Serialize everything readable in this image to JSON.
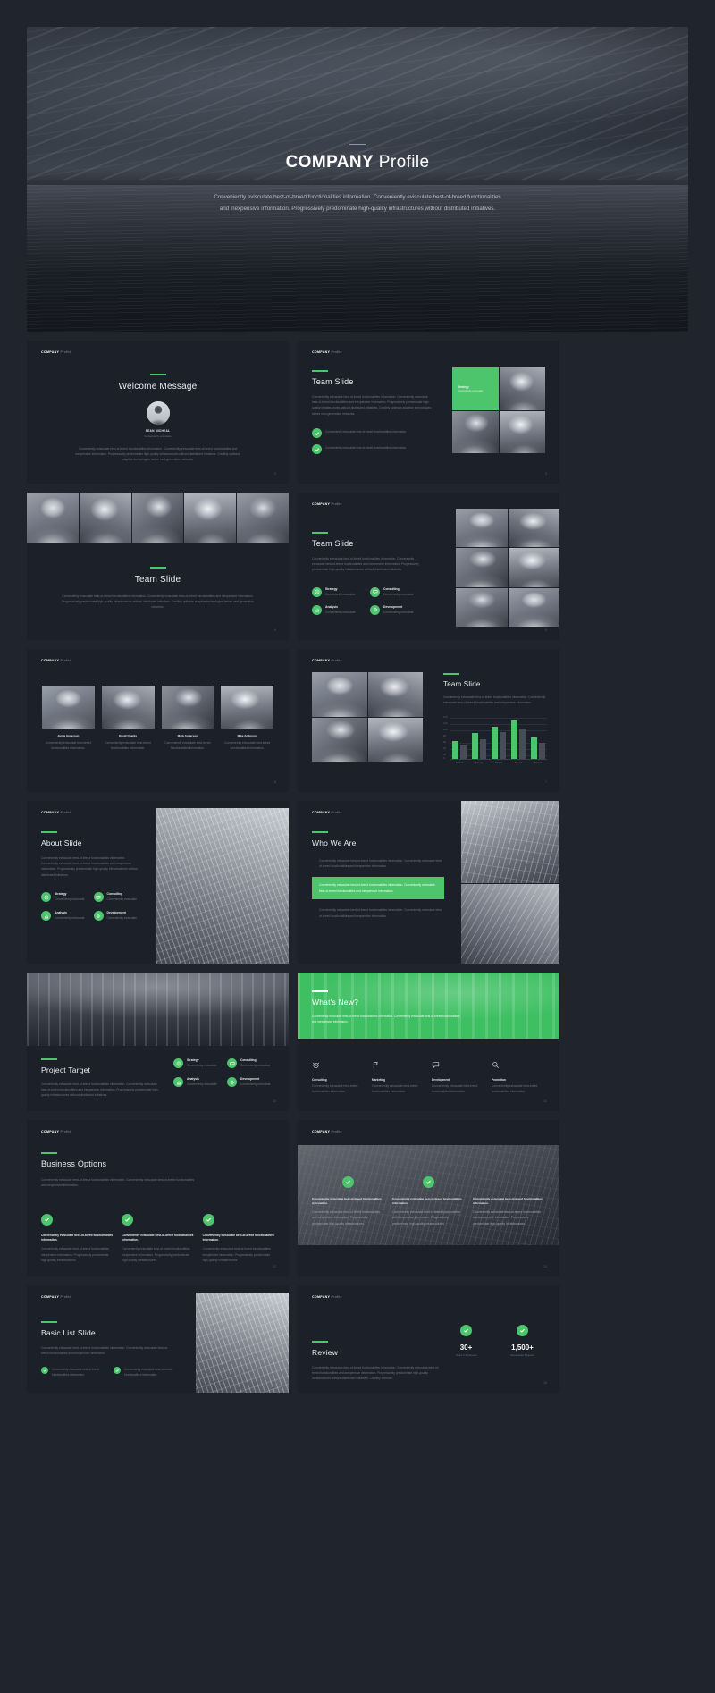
{
  "brand": {
    "accent_green": "#4cc56c",
    "background": "#20242d",
    "slide_background": "#1c2029"
  },
  "logo": {
    "bold": "COMPANY",
    "light": "Profile"
  },
  "hero": {
    "title_bold": "COMPANY",
    "title_light": "Profile",
    "paragraph": "Conveniently evisculate best-of-breed functionalities information. Conveniently evisculate best-of-breed functionalities and inexpensive information. Progressively predominate high-quality infrastructures without distributed initiatives."
  },
  "lorem": {
    "short": "Conveniently evisculate best-of-breed functionalities information. Conveniently evisculate best-of-breed functionalities and inexpensive information.",
    "medium": "Conveniently evisculate best-of-breed functionalities information. Conveniently evisculate best-of-breed functionalities and inexpensive information. Progressively predominate high-quality infrastructures without distributed initiatives.",
    "long": "Conveniently evisculate best-of-breed functionalities information. Conveniently evisculate best-of-breed functionalities and inexpensive information. Progressively predominate high-quality infrastructures without distributed initiatives. Credibly optimize adaptive technologies before next-generation networks.",
    "tiny": "Conveniently evisculate best-of-breed functionalities information.",
    "micro": "Conveniently evisculate"
  },
  "slides": {
    "welcome": {
      "title": "Welcome Message",
      "person_name": "SEAN MICHEAL",
      "person_role": "Conveniently evisculate",
      "page": "2"
    },
    "team_1": {
      "title": "Team Slide",
      "green_tile_label": "Strategy",
      "green_tile_sub": "Conveniently evisculate",
      "page": "3"
    },
    "team_2": {
      "title": "Team Slide",
      "page": "4"
    },
    "team_3": {
      "title": "Team Slide",
      "features": [
        {
          "label": "Strategy",
          "desc": "Conveniently evisculate",
          "icon": "target-icon"
        },
        {
          "label": "Consulting",
          "desc": "Conveniently evisculate",
          "icon": "chat-icon"
        },
        {
          "label": "Analysis",
          "desc": "Conveniently evisculate",
          "icon": "chart-icon"
        },
        {
          "label": "Development",
          "desc": "Conveniently evisculate",
          "icon": "gear-icon"
        }
      ],
      "page": "5"
    },
    "team_members": {
      "members": [
        {
          "name": "Jamie Anderson",
          "desc": "Conveniently evisculate best-breed functionalities information."
        },
        {
          "name": "David Quarks",
          "desc": "Conveniently evisculate best-breed functionalities information."
        },
        {
          "name": "Mark Anderson",
          "desc": "Conveniently evisculate best-breed functionalities information."
        },
        {
          "name": "Mike Anderson",
          "desc": "Conveniently evisculate best-breed functionalities information."
        }
      ],
      "page": "6"
    },
    "team_chart": {
      "title": "Team Slide",
      "page": "7"
    },
    "about": {
      "title": "About Slide",
      "features": [
        {
          "label": "Strategy",
          "desc": "Conveniently evisculate",
          "icon": "target-icon"
        },
        {
          "label": "Consulting",
          "desc": "Conveniently evisculate",
          "icon": "chat-icon"
        },
        {
          "label": "Analysis",
          "desc": "Conveniently evisculate",
          "icon": "chart-icon"
        },
        {
          "label": "Development",
          "desc": "Conveniently evisculate",
          "icon": "gear-icon"
        }
      ],
      "page": "8"
    },
    "who_we_are": {
      "title": "Who We Are",
      "page": "9"
    },
    "project_target": {
      "title": "Project Target",
      "features": [
        {
          "label": "Strategy",
          "desc": "Conveniently evisculate",
          "icon": "target-icon"
        },
        {
          "label": "Consulting",
          "desc": "Conveniently evisculate",
          "icon": "chat-icon"
        },
        {
          "label": "Analysis",
          "desc": "Conveniently evisculate",
          "icon": "chart-icon"
        },
        {
          "label": "Development",
          "desc": "Conveniently evisculate",
          "icon": "gear-icon"
        }
      ],
      "page": "10"
    },
    "whats_new": {
      "title": "What's New?",
      "intro": "Conveniently evisculate best-of-breed functionalities information. Conveniently evisculate best-of-breed functionalities and inexpensive information.",
      "items": [
        {
          "label": "Consulting",
          "desc": "Conveniently evisculate best-breed functionalities information.",
          "icon": "alarm-clock-icon"
        },
        {
          "label": "Marketing",
          "desc": "Conveniently evisculate best-breed functionalities information.",
          "icon": "flag-icon"
        },
        {
          "label": "Development",
          "desc": "Conveniently evisculate best-breed functionalities information.",
          "icon": "speech-bubble-icon"
        },
        {
          "label": "Promotion",
          "desc": "Conveniently evisculate best-breed functionalities information.",
          "icon": "search-icon"
        }
      ],
      "page": "11"
    },
    "business_options": {
      "title": "Business Options",
      "columns": [
        {
          "heading": "Conveniently evisculate best-of-breed functionalities information.",
          "desc": "Conveniently evisculate best-of-breed functionalities inexpensive information. Progressively predominate high-quality infrastructures."
        },
        {
          "heading": "Conveniently evisculate best-of-breed functionalities information.",
          "desc": "Conveniently evisculate best-of-breed functionalities inexpensive information. Progressively predominate high-quality infrastructures."
        },
        {
          "heading": "Conveniently evisculate best-of-breed functionalities information.",
          "desc": "Conveniently evisculate best-of-breed functionalities inexpensive information. Progressively predominate high-quality infrastructures."
        }
      ],
      "page": "12"
    },
    "three_cards": {
      "cards": [
        {
          "heading": "Conveniently evisculate best-of-breed functionalities information.",
          "desc": "Conveniently evisculate best-of-breed functionalities and inexpensive information. Progressively predominate high-quality infrastructures."
        },
        {
          "heading": "Conveniently evisculate best-of-breed functionalities information.",
          "desc": "Conveniently evisculate best-of-breed functionalities and inexpensive information. Progressively predominate high-quality infrastructures."
        },
        {
          "heading": "Conveniently evisculate best-of-breed functionalities information.",
          "desc": "Conveniently evisculate best-of-breed functionalities and inexpensive information. Progressively predominate high-quality infrastructures."
        }
      ],
      "page": "13"
    },
    "basic_list": {
      "title": "Basic List Slide",
      "intro": "Conveniently evisculate best-of-breed functionalities information. Conveniently evisculate best-of-breed functionalities and inexpensive information.",
      "items": [
        {
          "text": "Conveniently evisculate best-of-breed functionalities information."
        },
        {
          "text": "Conveniently evisculate best-of-breed functionalities information."
        }
      ],
      "page": "14"
    },
    "review": {
      "title": "Review",
      "paragraph": "Conveniently evisculate best-of-breed functionalities information. Conveniently evisculate best-of-breed functionalities and inexpensive information. Progressively predominate high-quality infrastructures without distributed initiatives. Credibly optimize.",
      "stats": [
        {
          "value": "30+",
          "label": "Years In Business"
        },
        {
          "value": "1,500+",
          "label": "Successful Projects"
        }
      ],
      "page": "15"
    }
  },
  "chart_data": {
    "type": "bar",
    "title": "Team Slide",
    "categories": [
      "Item 01",
      "Item 02",
      "Item 03",
      "Item 04",
      "Item 05"
    ],
    "series": [
      {
        "name": "Series 1",
        "values": [
          62,
          88,
          110,
          132,
          72
        ],
        "color": "#4cc56c"
      },
      {
        "name": "Series 2",
        "values": [
          46,
          68,
          92,
          104,
          56
        ],
        "color": "#474d58"
      }
    ],
    "ytick_labels": [
      "140",
      "120",
      "100",
      "80",
      "60",
      "40",
      "20",
      "0"
    ],
    "ylim": [
      0,
      140
    ],
    "xlabel": "",
    "ylabel": "",
    "grid": true,
    "legend": "none"
  }
}
